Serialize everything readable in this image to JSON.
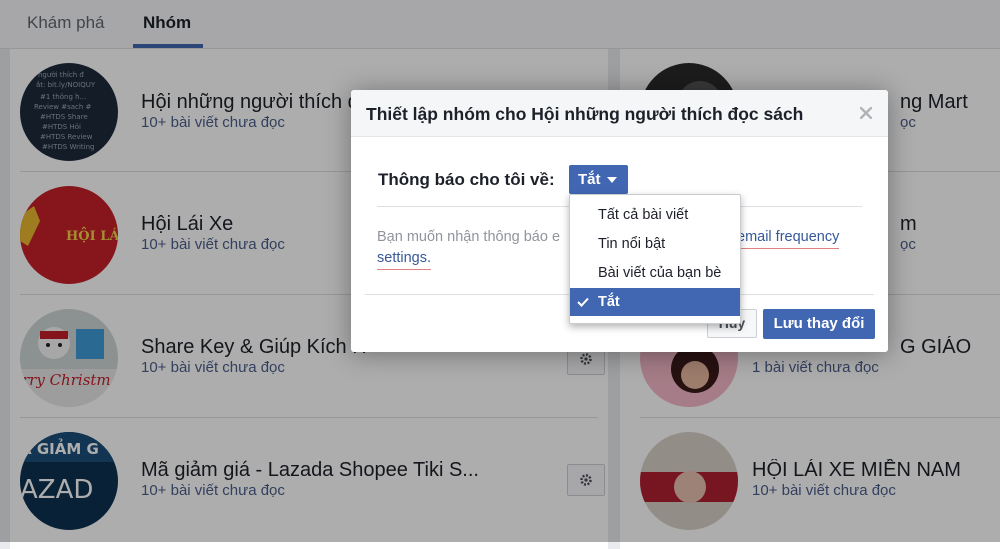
{
  "tabs": [
    {
      "label": "Khám phá",
      "active": false
    },
    {
      "label": "Nhóm",
      "active": true
    }
  ],
  "groups_left": [
    {
      "name": "Hội những người thích đ",
      "sub": "10+ bài viết chưa đọc"
    },
    {
      "name": "Hội Lái Xe",
      "sub": "10+ bài viết chưa đọc"
    },
    {
      "name": "Share Key & Giúp Kích H",
      "sub": "10+ bài viết chưa đọc"
    },
    {
      "name": "Mã giảm giá - Lazada Shopee Tiki S...",
      "sub": "10+ bài viết chưa đọc"
    }
  ],
  "groups_right": [
    {
      "name": "ng Mart",
      "sub": "ọc"
    },
    {
      "name": "m",
      "sub": "ọc"
    },
    {
      "name": "G GIÁO",
      "sub": "1 bài viết chưa đọc"
    },
    {
      "name": "HỘI LÁI XE MIỀN NAM",
      "sub": "10+ bài viết chưa đọc"
    }
  ],
  "avatar_text": {
    "hoi_lai": "HỘI LÁI",
    "christmas": "rry Christm",
    "magiam": "Ã GIẢM G",
    "lazada": "AZAD"
  },
  "dialog": {
    "title": "Thiết lập nhóm cho Hội những người thích đọc sách",
    "notify_label": "Thông báo cho tôi về:",
    "selected": "Tắt",
    "desc_part1": "Bạn muốn nhận thông báo e",
    "desc_link1": "email frequency",
    "desc_link2": "settings.",
    "cancel": "Hủy",
    "save": "Lưu thay đổi",
    "options": [
      "Tất cả bài viết",
      "Tin nổi bật",
      "Bài viết của bạn bè",
      "Tắt"
    ],
    "selected_index": 3
  },
  "colors": {
    "accent": "#4267b2",
    "link": "#365899",
    "subtext": "#4b5f8b"
  }
}
